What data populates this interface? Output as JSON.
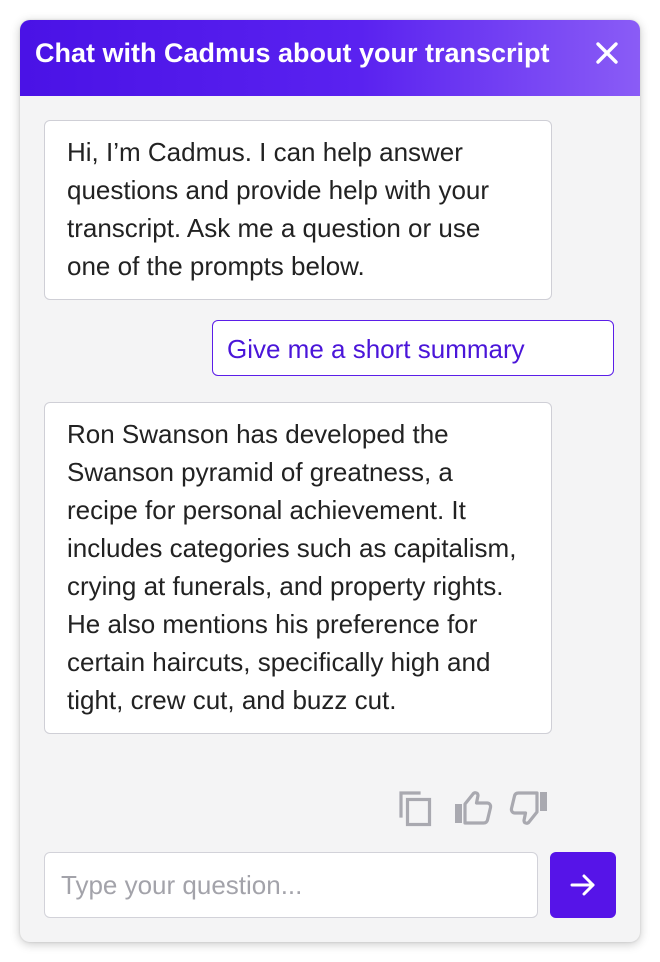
{
  "header": {
    "title": "Chat with Cadmus about your transcript",
    "close_icon": "close-icon",
    "gradient_start": "#4a12e6",
    "gradient_end": "#8a5cf6"
  },
  "messages": [
    {
      "role": "assistant",
      "text": "Hi, I’m Cadmus. I can help answer questions and provide help with your transcript. Ask me a question or use one of the prompts below."
    },
    {
      "role": "user",
      "text": "Give me a short summary"
    },
    {
      "role": "assistant",
      "text": "Ron Swanson has developed the Swanson pyramid of greatness, a recipe for personal achievement. It includes categories such as capitalism, crying at funerals, and property rights. He also mentions his preference for certain haircuts, specifically high and tight, crew cut, and buzz cut."
    }
  ],
  "message_actions": [
    {
      "icon": "copy-icon"
    },
    {
      "icon": "thumbs-up-icon"
    },
    {
      "icon": "thumbs-down-icon"
    }
  ],
  "composer": {
    "placeholder": "Type your question...",
    "value": "",
    "send_icon": "arrow-right-icon"
  },
  "colors": {
    "accent": "#5614e8",
    "panel_bg": "#f4f4f5",
    "icon_gray": "#a9a9b0"
  }
}
